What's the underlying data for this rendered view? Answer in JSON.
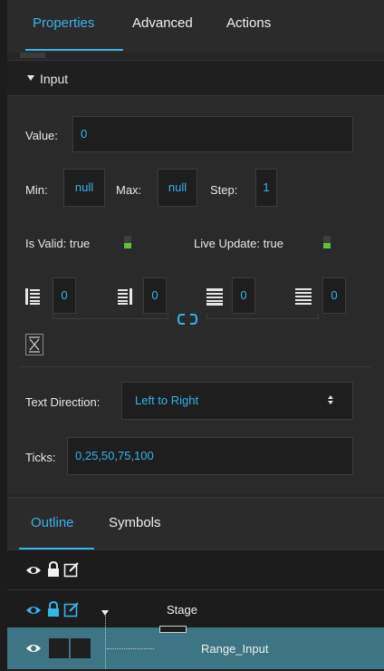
{
  "tabs": {
    "properties": "Properties",
    "advanced": "Advanced",
    "actions": "Actions"
  },
  "section": {
    "title": "Input"
  },
  "fields": {
    "value_label": "Value:",
    "value": "0",
    "min_label": "Min:",
    "min": "null",
    "max_label": "Max:",
    "max": "null",
    "step_label": "Step:",
    "step": "1",
    "is_valid_label": "Is Valid: true",
    "live_update_label": "Live Update: true"
  },
  "alignment": {
    "left": "0",
    "right": "0",
    "center": "0",
    "justify": "0"
  },
  "text_direction": {
    "label": "Text Direction:",
    "value": "Left to Right"
  },
  "ticks": {
    "label": "Ticks:",
    "value": "0,25,50,75,100"
  },
  "outline": {
    "tabs": {
      "outline": "Outline",
      "symbols": "Symbols"
    },
    "rows": {
      "stage": "Stage",
      "range_input": "Range_Input"
    }
  },
  "colors": {
    "accent": "#36b4e6",
    "toggle_on": "#5fbf3f",
    "selected_row": "#3d7584"
  },
  "icons": [
    "eye-icon",
    "lock-icon",
    "edit-icon",
    "link-icon",
    "collapse-icon",
    "align-left-icon",
    "align-right-icon",
    "align-center-icon",
    "align-justify-icon"
  ]
}
